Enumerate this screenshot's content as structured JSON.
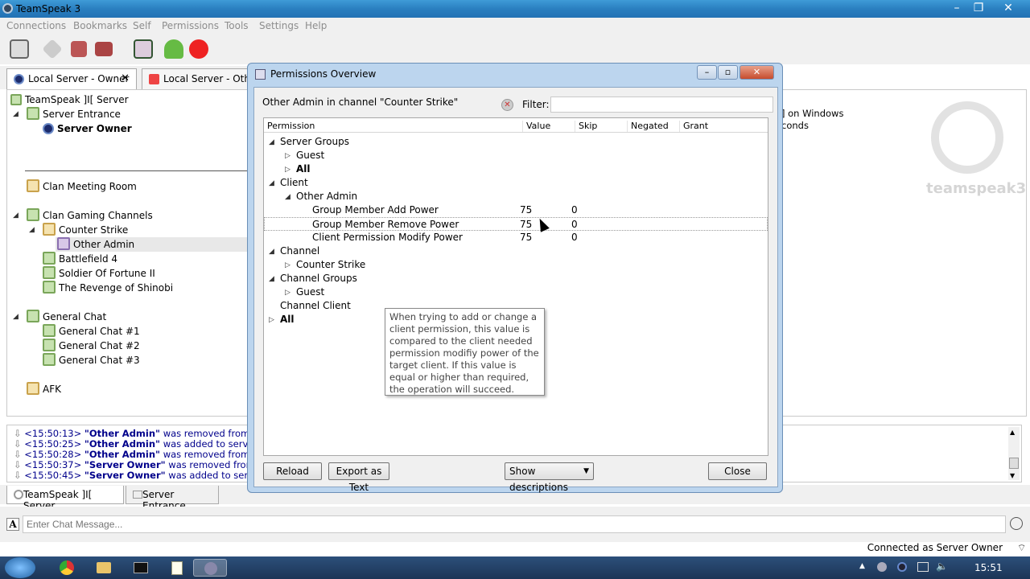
{
  "window": {
    "title": "TeamSpeak 3"
  },
  "menu": [
    "Connections",
    "Bookmarks",
    "Self",
    "Permissions",
    "Tools",
    "Settings",
    "Help"
  ],
  "server_tabs": [
    {
      "label": "Local Server - Owner",
      "close": "✕"
    },
    {
      "label": "Local Server - Other A"
    }
  ],
  "tree": {
    "server": "TeamSpeak ]I[ Server",
    "server_entrance": "Server Entrance",
    "server_owner": "Server Owner",
    "clan_meeting": "Clan Meeting Room",
    "clan_gaming": "Clan Gaming Channels",
    "counter_strike": "Counter Strike",
    "other_admin": "Other Admin",
    "bf4": "Battlefield 4",
    "sof2": "Soldier Of Fortune II",
    "shinobi": "The Revenge of Shinobi",
    "general_chat": "General Chat",
    "gc1": "General Chat #1",
    "gc2": "General Chat #2",
    "gc3": "General Chat #3",
    "afk": "AFK"
  },
  "right_panel": {
    "line1": "] on Windows",
    "line2": "conds",
    "logo_text": "teamspeak3"
  },
  "log": [
    {
      "time": "<15:50:13>",
      "name": "\"Other Admin\"",
      "text": "was removed from server g"
    },
    {
      "time": "<15:50:25>",
      "name": "\"Other Admin\"",
      "text": "was added to server group"
    },
    {
      "time": "<15:50:28>",
      "name": "\"Other Admin\"",
      "text": "was removed from server g"
    },
    {
      "time": "<15:50:37>",
      "name": "\"Server Owner\"",
      "text": "was removed from server"
    },
    {
      "time": "<15:50:45>",
      "name": "\"Server Owner\"",
      "text": "was added to server grou"
    }
  ],
  "bottom_tabs": [
    "TeamSpeak ]I[ Server",
    "Server Entrance"
  ],
  "chat": {
    "placeholder": "Enter Chat Message..."
  },
  "status": "Connected as Server Owner",
  "clock": "15:51",
  "dialog": {
    "title": "Permissions Overview",
    "context": "Other Admin in channel \"Counter Strike\"",
    "filter_label": "Filter:",
    "columns": [
      "Permission",
      "Value",
      "Skip",
      "Negated",
      "Grant"
    ],
    "rows": {
      "server_groups": "Server Groups",
      "guest1": "Guest",
      "all1": "All",
      "client": "Client",
      "other_admin": "Other Admin",
      "gm_add": {
        "label": "Group Member Add Power",
        "value": "75",
        "skip": "0"
      },
      "gm_remove": {
        "label": "Group Member Remove Power",
        "value": "75",
        "skip": "0"
      },
      "cp_modify": {
        "label": "Client Permission Modify Power",
        "value": "75",
        "skip": "0"
      },
      "channel": "Channel",
      "counter_strike": "Counter Strike",
      "channel_groups": "Channel Groups",
      "guest2": "Guest",
      "channel_client": "Channel Client",
      "all2": "All"
    },
    "tooltip": "When trying to add or change a client permission, this value is compared to the client needed permission modifiy power of the target client. If this value is equal or higher than required, the operation will succeed.",
    "buttons": {
      "reload": "Reload",
      "export": "Export as Text",
      "descriptions": "Show descriptions",
      "close": "Close"
    }
  }
}
